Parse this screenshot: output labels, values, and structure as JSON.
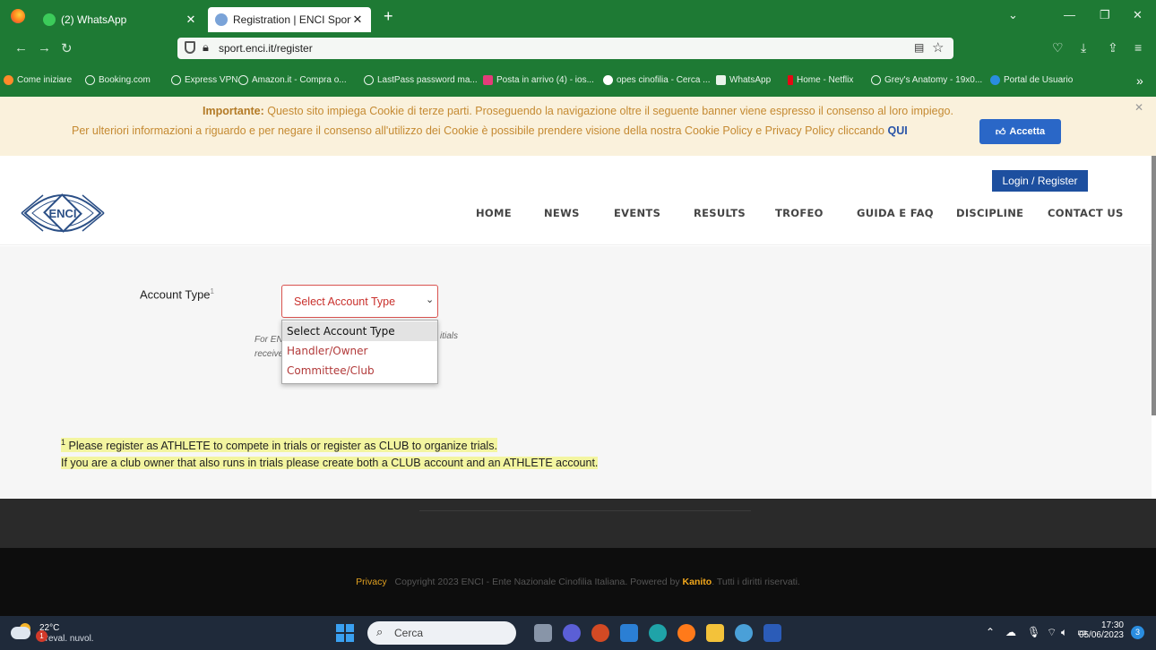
{
  "browser": {
    "tabs": [
      {
        "title": "(2) WhatsApp",
        "active": false
      },
      {
        "title": "Registration | ENCI Sport",
        "active": true
      }
    ],
    "url": "sport.enci.it/register",
    "bookmarks": [
      "Come iniziare",
      "Booking.com",
      "Express VPN",
      "Amazon.it - Compra o...",
      "LastPass password ma...",
      "Posta in arrivo (4) - ios...",
      "opes cinofilia - Cerca ...",
      "WhatsApp",
      "Home - Netflix",
      "Grey's Anatomy - 19x0...",
      "Portal de Usuario"
    ],
    "accent_color": "#1e7a34"
  },
  "cookie": {
    "important_label": "Importante:",
    "line1": "Questo sito impiega Cookie di terze parti. Proseguendo la navigazione oltre il seguente banner viene espresso il consenso al loro impiego.",
    "line2": "Per ulteriori informazioni a riguardo e per negare il consenso all'utilizzo dei Cookie è possibile prendere visione della nostra Cookie Policy e Privacy Policy cliccando",
    "link": "QUI",
    "accept_label": "Accetta"
  },
  "header": {
    "login_label": "Login / Register",
    "menu": [
      "HOME",
      "NEWS",
      "EVENTS",
      "RESULTS",
      "TROFEO",
      "GUIDA E FAQ",
      "DISCIPLINE",
      "CONTACT US"
    ],
    "logo_text": "ENCI"
  },
  "form": {
    "account_type_label": "Account Type",
    "account_type_sup": "1",
    "select_value": "Select Account Type",
    "options": [
      "Select Account Type",
      "Handler/Owner",
      "Committee/Club"
    ],
    "hint_left_1": "For EN",
    "hint_left_2": "receive",
    "hint_right": "itials"
  },
  "notes": {
    "sup": "1",
    "line1": "Please register as ATHLETE to compete in trials or register as CLUB to organize trials.",
    "line2": "If you are a club owner that also runs in trials please create both a CLUB account and an ATHLETE account."
  },
  "footer": {
    "privacy": "Privacy",
    "copyright": "Copyright 2023 ENCI - Ente Nazionale Cinofilia Italiana. Powered by",
    "powered_by": "Kanito",
    "rights": ". Tutti i diritti riservati."
  },
  "taskbar": {
    "temperature": "22°C",
    "condition": "Preval. nuvol.",
    "weather_badge": "1",
    "search_placeholder": "Cerca",
    "time": "17:30",
    "date": "05/06/2023",
    "notifications": "3"
  }
}
